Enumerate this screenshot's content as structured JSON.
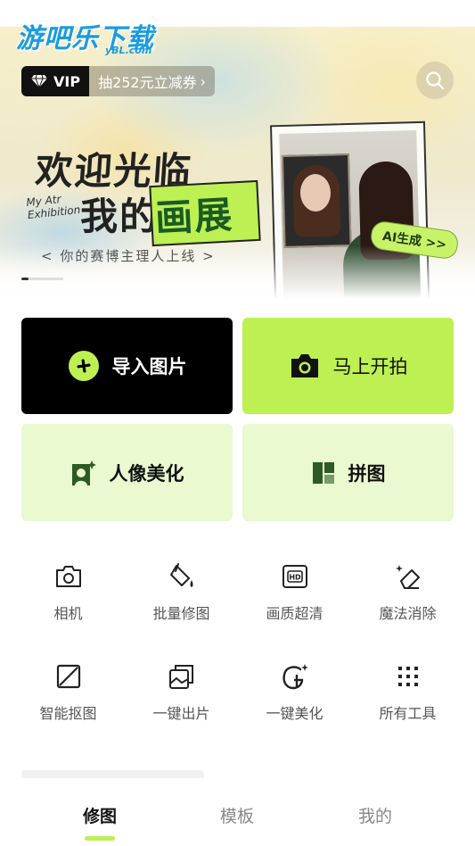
{
  "colors": {
    "accent": "#bdf052",
    "accent_light": "#eaf9cf",
    "dark": "#000000"
  },
  "logo": {
    "main": "游吧乐下载",
    "sub": "yBL.com"
  },
  "vip": {
    "label": "VIP",
    "promo": "抽252元立减券"
  },
  "banner": {
    "headline_line1": "欢迎光临",
    "headline_line2_a": "我的",
    "headline_line2_b": "画展",
    "english": "My Atr\nExhibition",
    "tagline": "< 你的赛博主理人上线 >",
    "ai_tag": "AI生成 >>",
    "slide_progress": 0.17
  },
  "actions": {
    "import": "导入图片",
    "shoot": "马上开拍",
    "portrait": "人像美化",
    "collage": "拼图"
  },
  "tools": [
    {
      "label": "相机",
      "icon": "camera-icon"
    },
    {
      "label": "批量修图",
      "icon": "paint-bucket-icon"
    },
    {
      "label": "画质超清",
      "icon": "hd-icon"
    },
    {
      "label": "魔法消除",
      "icon": "eraser-sparkle-icon"
    },
    {
      "label": "智能抠图",
      "icon": "cutout-icon"
    },
    {
      "label": "一键出片",
      "icon": "stack-photo-icon"
    },
    {
      "label": "一键美化",
      "icon": "beautify-icon"
    },
    {
      "label": "所有工具",
      "icon": "grid-dots-icon"
    }
  ],
  "nav": {
    "tabs": [
      "修图",
      "模板",
      "我的"
    ],
    "active": "修图"
  }
}
